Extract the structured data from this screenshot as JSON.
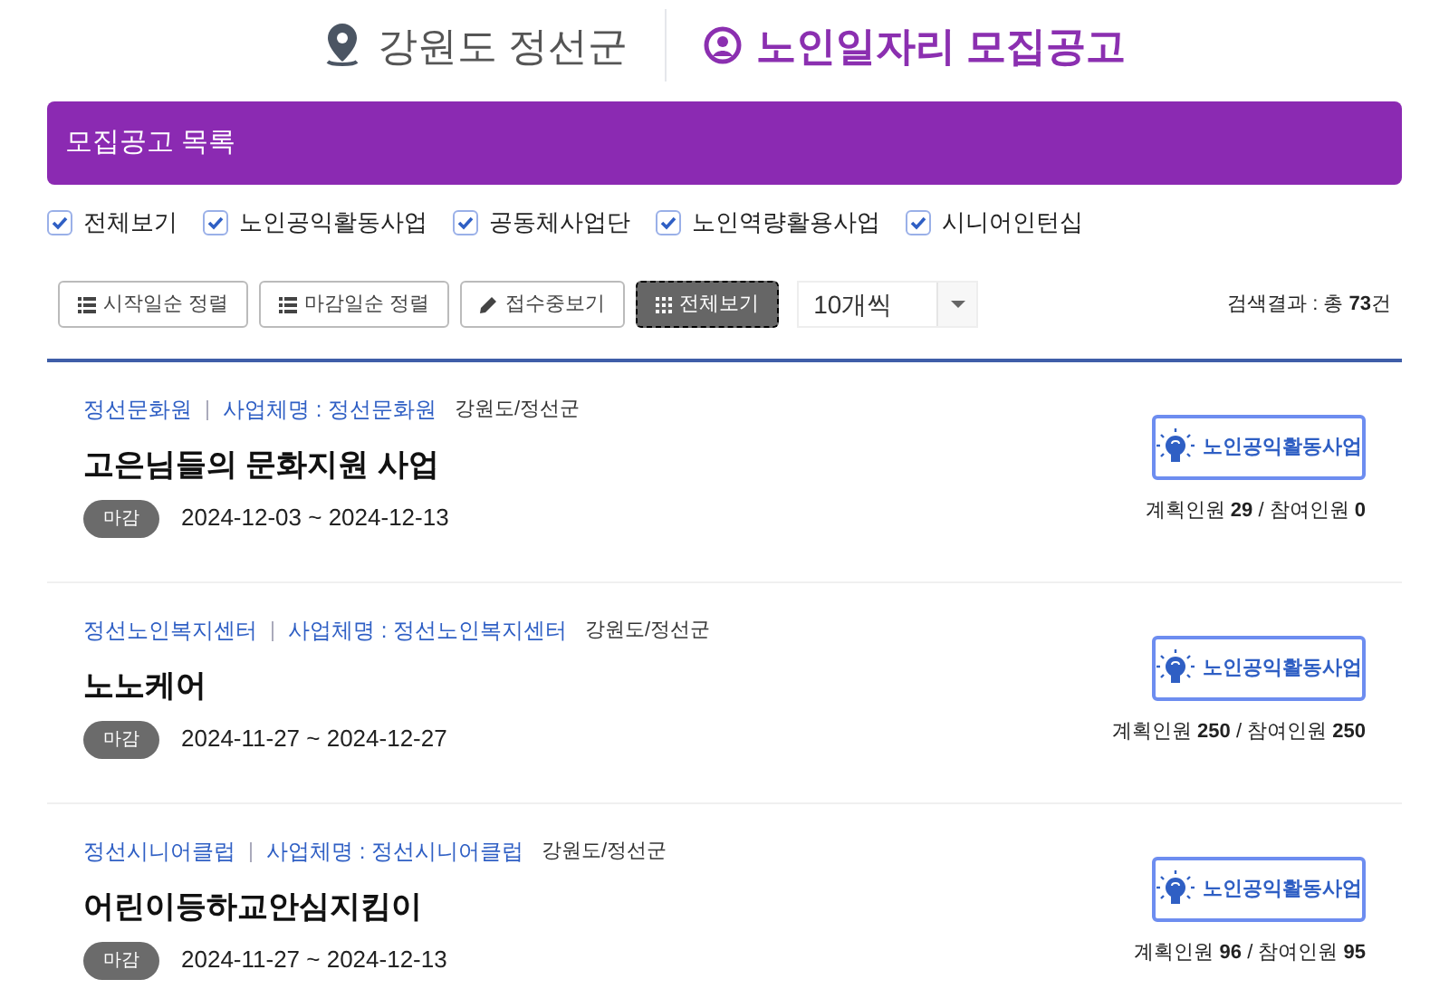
{
  "header": {
    "region": "강원도 정선군",
    "title": "노인일자리 모집공고"
  },
  "panel_title": "모집공고 목록",
  "filters": [
    {
      "label": "전체보기",
      "checked": true
    },
    {
      "label": "노인공익활동사업",
      "checked": true
    },
    {
      "label": "공동체사업단",
      "checked": true
    },
    {
      "label": "노인역량활용사업",
      "checked": true
    },
    {
      "label": "시니어인턴십",
      "checked": true
    }
  ],
  "toolbar": {
    "buttons": [
      {
        "label": "시작일순 정렬",
        "kind": "list",
        "selected": false
      },
      {
        "label": "마감일순 정렬",
        "kind": "list",
        "selected": false
      },
      {
        "label": "접수중보기",
        "kind": "pencil",
        "selected": false
      },
      {
        "label": "전체보기",
        "kind": "grid",
        "selected": true
      }
    ],
    "page_size": "10개씩",
    "result": "검색결과 : 총 **73**건"
  },
  "postings": [
    {
      "org": "정선문화원",
      "operator": "사업체명 : 정선문화원",
      "location": "강원도/정선군",
      "title": "고은님들의 문화지원 사업",
      "status": "마감",
      "period": "2024-12-03 ~ 2024-12-13",
      "category": "노인공익활동사업",
      "counts": "계획인원 **29** / 참여인원 **0**"
    },
    {
      "org": "정선노인복지센터",
      "operator": "사업체명 : 정선노인복지센터",
      "location": "강원도/정선군",
      "title": "노노케어",
      "status": "마감",
      "period": "2024-11-27 ~ 2024-12-27",
      "category": "노인공익활동사업",
      "counts": "계획인원 **250** / 참여인원 **250**"
    },
    {
      "org": "정선시니어클럽",
      "operator": "사업체명 : 정선시니어클럽",
      "location": "강원도/정선군",
      "title": "어린이등하교안심지킴이",
      "status": "마감",
      "period": "2024-11-27 ~ 2024-12-13",
      "category": "노인공익활동사업",
      "counts": "계획인원 **96** / 참여인원 **95**"
    }
  ]
}
